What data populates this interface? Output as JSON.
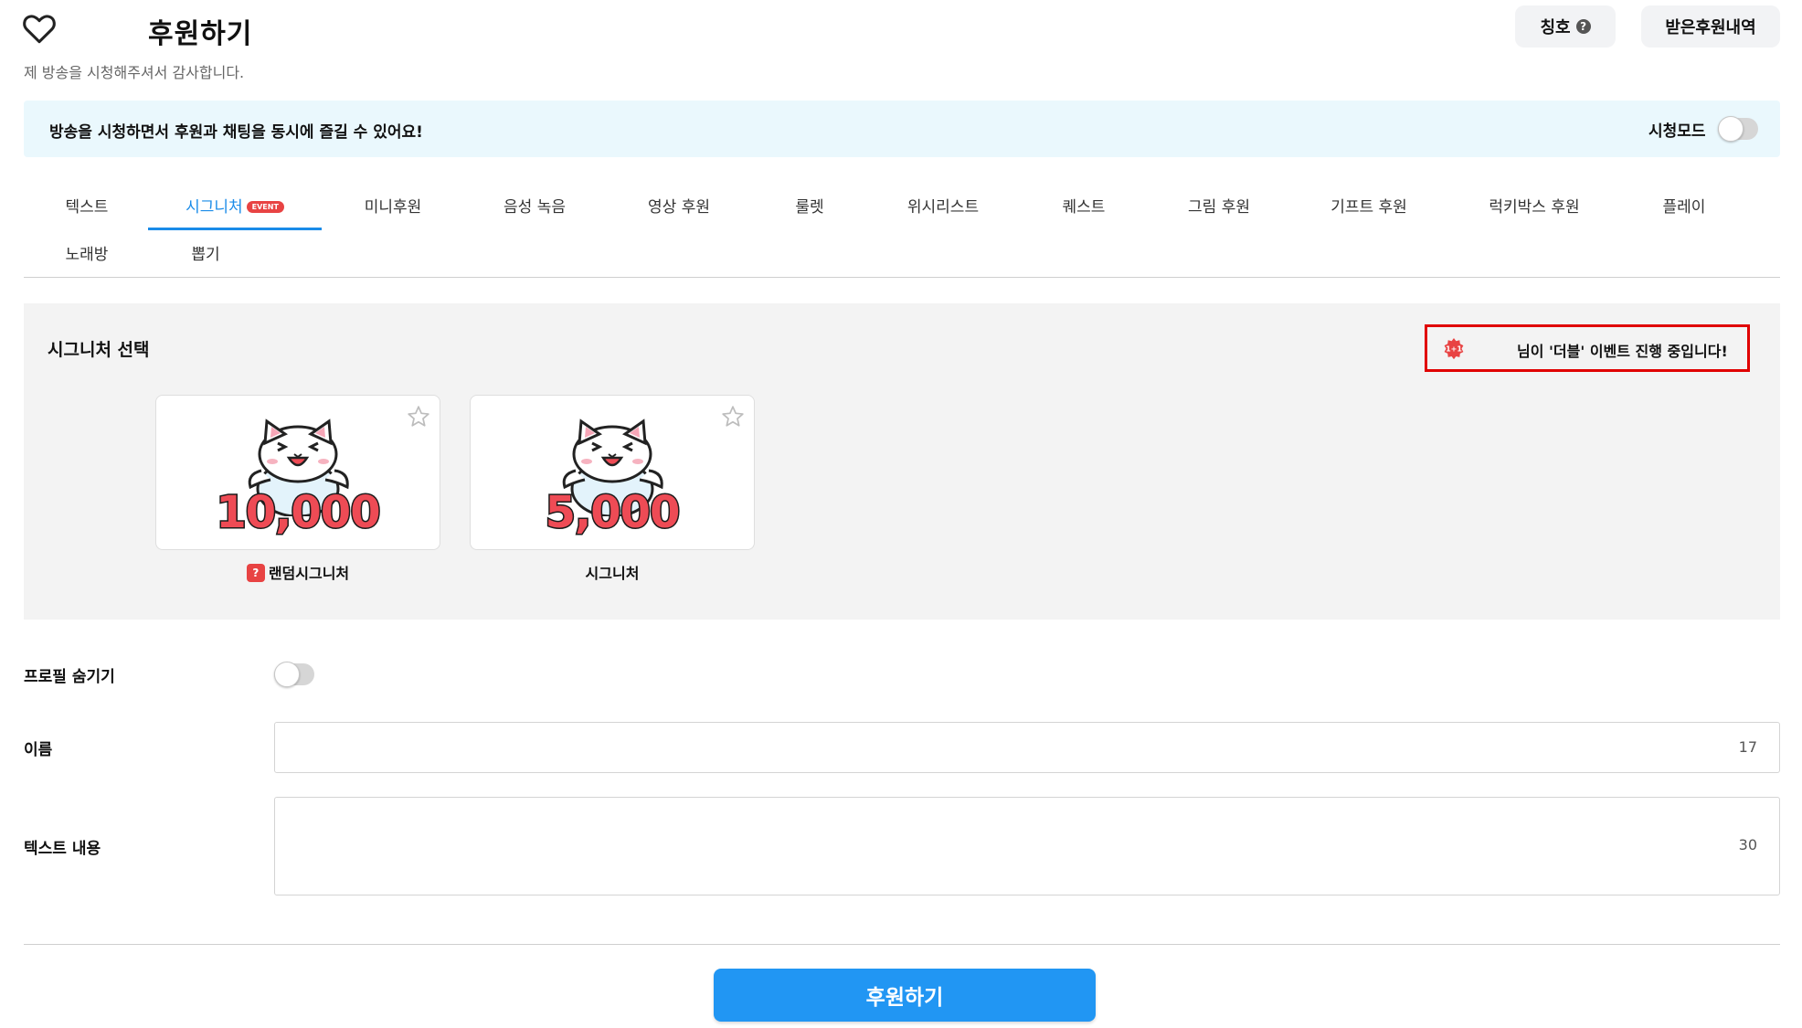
{
  "header": {
    "title": "후원하기",
    "subtitle": "제 방송을 시청해주셔서 감사합니다.",
    "title_button": "칭호",
    "help_glyph": "?",
    "history_button": "받은후원내역",
    "icons": [
      "heart-icon",
      "help-icon"
    ]
  },
  "banner": {
    "text": "방송을 시청하면서 후원과 채팅을 동시에 즐길 수 있어요!",
    "watch_mode_label": "시청모드",
    "watch_mode_on": false
  },
  "tabs": [
    {
      "label": "텍스트"
    },
    {
      "label": "시그니처",
      "badge": "EVENT",
      "active": true
    },
    {
      "label": "미니후원"
    },
    {
      "label": "음성 녹음"
    },
    {
      "label": "영상 후원"
    },
    {
      "label": "룰렛"
    },
    {
      "label": "위시리스트"
    },
    {
      "label": "퀘스트"
    },
    {
      "label": "그림 후원"
    },
    {
      "label": "기프트 후원"
    },
    {
      "label": "럭키박스 후원"
    },
    {
      "label": "플레이"
    },
    {
      "label": "노래방"
    },
    {
      "label": "뽑기"
    }
  ],
  "signature": {
    "section_title": "시그니처 선택",
    "event_icon_text": "1+1",
    "event_text": "님이 '더블' 이벤트 진행 중입니다!",
    "cards": [
      {
        "amount": "10,000",
        "label": "랜덤시그니처",
        "badge": "?",
        "favorite": false
      },
      {
        "amount": "5,000",
        "label": "시그니처",
        "favorite": false
      }
    ]
  },
  "form": {
    "hide_profile_label": "프로필 숨기기",
    "hide_profile_on": false,
    "name_label": "이름",
    "name_value": "",
    "name_counter": "17",
    "text_label": "텍스트 내용",
    "text_value": "",
    "text_counter": "30"
  },
  "submit_label": "후원하기",
  "colors": {
    "accent": "#2196f3",
    "active_tab": "#1a8be8",
    "banner_bg": "#eaf8fd",
    "event_red": "#e84343",
    "highlight_border": "#e00000"
  }
}
